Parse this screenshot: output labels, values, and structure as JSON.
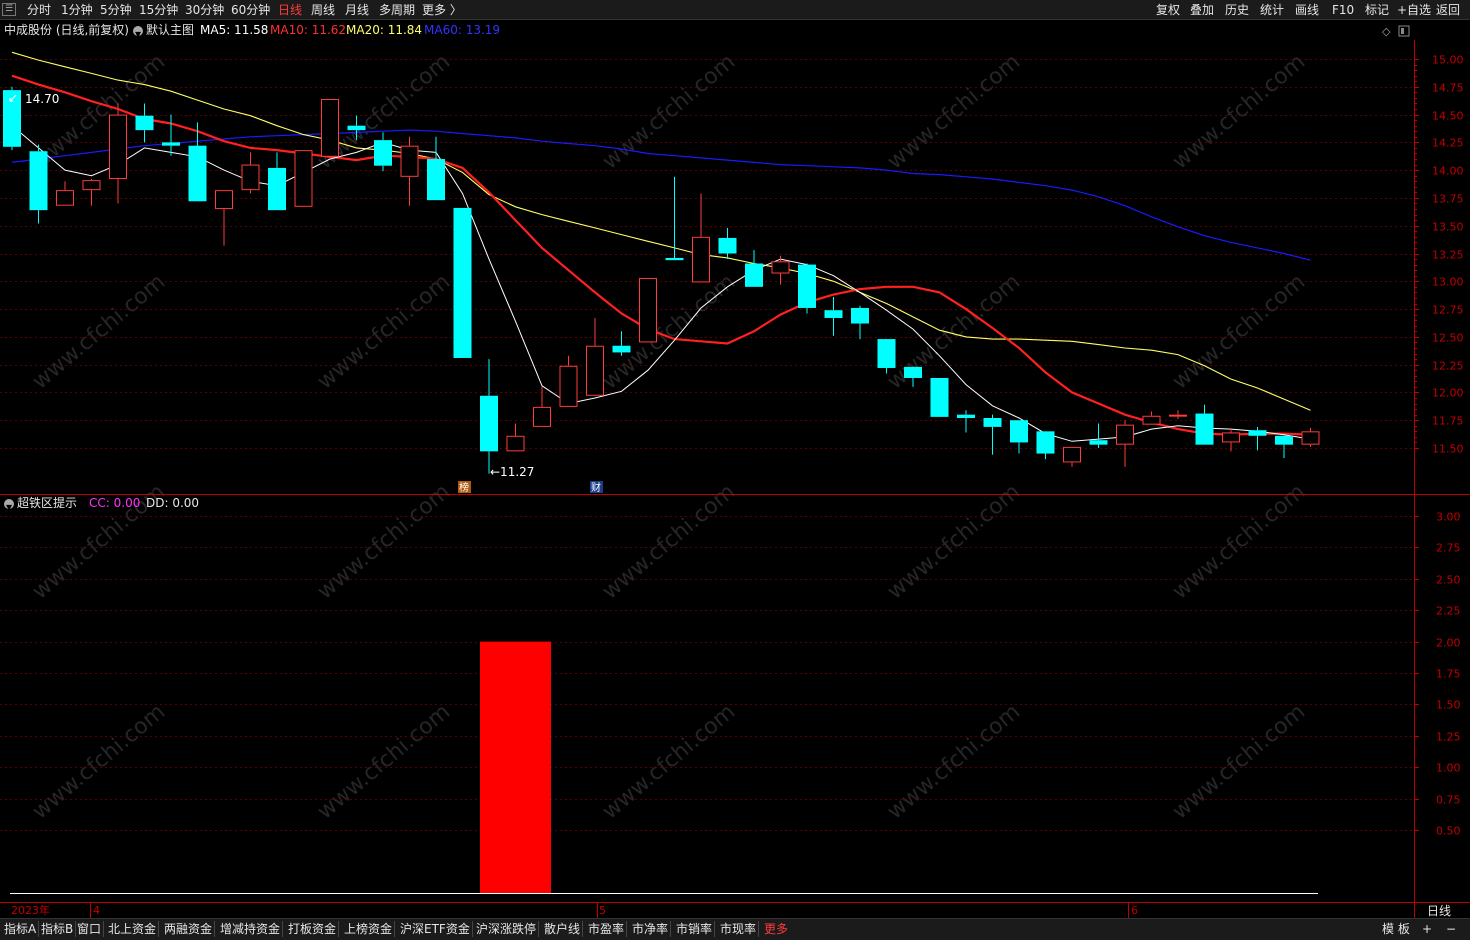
{
  "toolbar": {
    "periods": [
      "分时",
      "1分钟",
      "5分钟",
      "15分钟",
      "30分钟",
      "60分钟",
      "日线",
      "周线",
      "月线",
      "多周期",
      "更多 〉"
    ],
    "active_period": "日线",
    "actions": [
      "复权",
      "叠加",
      "历史",
      "统计",
      "画线",
      "F10",
      "标记",
      "+自选",
      "返回"
    ]
  },
  "infobar": {
    "stock": "中成股份 (日线,前复权)",
    "main_chart": "默认主图",
    "ma5": "MA5: 11.58",
    "ma10": "MA10: 11.62",
    "ma20": "MA20: 11.84",
    "ma60": "MA60: 13.19"
  },
  "colors": {
    "up": "#ff3b3b",
    "down": "#00ffff",
    "ma5": "#ffffff",
    "ma10": "#ff2020",
    "ma20": "#ffff66",
    "ma60": "#1a1aff",
    "axis": "#c00000"
  },
  "price_axis": [
    "15.00",
    "14.75",
    "14.50",
    "14.25",
    "14.00",
    "13.75",
    "13.50",
    "13.25",
    "13.00",
    "12.75",
    "12.50",
    "12.25",
    "12.00",
    "11.75",
    "11.50"
  ],
  "annotations": {
    "high_label": "14.70",
    "low_label": "←11.27",
    "marker_1": "榜",
    "marker_2": "财"
  },
  "indicator": {
    "name": "超铁区提示",
    "cc": "CC: 0.00",
    "dd": "DD: 0.00",
    "axis": [
      "3.00",
      "2.75",
      "2.50",
      "2.25",
      "2.00",
      "1.75",
      "1.50",
      "1.25",
      "1.00",
      "0.75",
      "0.50"
    ],
    "bar_value": 2.0
  },
  "time_axis": {
    "year": "2023年",
    "months": [
      "4",
      "5",
      "6"
    ],
    "period_label": "日线"
  },
  "bottom_tabs": [
    "指标A",
    "指标B",
    "窗口",
    "北上资金",
    "两融资金",
    "增减持资金",
    "打板资金",
    "上榜资金",
    "沪深ETF资金",
    "沪深涨跌停",
    "散户线",
    "市盈率",
    "市净率",
    "市销率",
    "市现率",
    "更多"
  ],
  "bottom_right": {
    "template": "模 板",
    "plus": "+",
    "minus": "−"
  },
  "watermark": "www.cfchi.com",
  "chart_data": {
    "type": "candlestick",
    "candles": [
      {
        "o": 14.72,
        "h": 14.75,
        "c": 14.21,
        "l": 14.18
      },
      {
        "o": 14.17,
        "h": 14.23,
        "c": 13.64,
        "l": 13.52
      },
      {
        "o": 13.68,
        "h": 13.9,
        "c": 13.82,
        "l": 13.68
      },
      {
        "o": 13.82,
        "h": 13.92,
        "c": 13.91,
        "l": 13.68
      },
      {
        "o": 13.92,
        "h": 14.6,
        "c": 14.5,
        "l": 13.7
      },
      {
        "o": 14.49,
        "h": 14.6,
        "c": 14.36,
        "l": 14.25
      },
      {
        "o": 14.25,
        "h": 14.5,
        "c": 14.22,
        "l": 14.13
      },
      {
        "o": 14.22,
        "h": 14.43,
        "c": 13.72,
        "l": 13.72
      },
      {
        "o": 13.65,
        "h": 13.82,
        "c": 13.82,
        "l": 13.32
      },
      {
        "o": 13.82,
        "h": 14.16,
        "c": 14.05,
        "l": 13.79
      },
      {
        "o": 14.02,
        "h": 14.16,
        "c": 13.64,
        "l": 13.64
      },
      {
        "o": 13.67,
        "h": 14.18,
        "c": 14.18,
        "l": 13.67
      },
      {
        "o": 14.12,
        "h": 14.64,
        "c": 14.64,
        "l": 14.1
      },
      {
        "o": 14.4,
        "h": 14.49,
        "c": 14.36,
        "l": 14.27
      },
      {
        "o": 14.27,
        "h": 14.34,
        "c": 14.04,
        "l": 13.99
      },
      {
        "o": 13.94,
        "h": 14.3,
        "c": 14.22,
        "l": 13.68
      },
      {
        "o": 14.1,
        "h": 14.3,
        "c": 13.73,
        "l": 13.73
      },
      {
        "o": 13.66,
        "h": 13.66,
        "c": 12.31,
        "l": 12.31
      },
      {
        "o": 11.97,
        "h": 12.3,
        "c": 11.47,
        "l": 11.27
      },
      {
        "o": 11.47,
        "h": 11.72,
        "c": 11.61,
        "l": 11.47
      },
      {
        "o": 11.69,
        "h": 12.05,
        "c": 11.87,
        "l": 11.69
      },
      {
        "o": 11.87,
        "h": 12.33,
        "c": 12.24,
        "l": 11.87
      },
      {
        "o": 11.97,
        "h": 12.67,
        "c": 12.42,
        "l": 11.97
      },
      {
        "o": 12.42,
        "h": 12.55,
        "c": 12.36,
        "l": 12.33
      },
      {
        "o": 12.45,
        "h": 13.03,
        "c": 13.03,
        "l": 12.45
      },
      {
        "o": 13.21,
        "h": 13.94,
        "c": 13.19,
        "l": 13.19
      },
      {
        "o": 12.99,
        "h": 13.79,
        "c": 13.4,
        "l": 12.99
      },
      {
        "o": 13.39,
        "h": 13.48,
        "c": 13.25,
        "l": 13.2
      },
      {
        "o": 13.16,
        "h": 13.28,
        "c": 12.95,
        "l": 12.95
      },
      {
        "o": 13.07,
        "h": 13.23,
        "c": 13.18,
        "l": 12.97
      },
      {
        "o": 13.15,
        "h": 13.16,
        "c": 12.76,
        "l": 12.71
      },
      {
        "o": 12.74,
        "h": 12.86,
        "c": 12.67,
        "l": 12.51
      },
      {
        "o": 12.76,
        "h": 12.78,
        "c": 12.62,
        "l": 12.48
      },
      {
        "o": 12.48,
        "h": 12.48,
        "c": 12.22,
        "l": 12.17
      },
      {
        "o": 12.23,
        "h": 12.23,
        "c": 12.13,
        "l": 12.05
      },
      {
        "o": 12.13,
        "h": 12.13,
        "c": 11.78,
        "l": 11.78
      },
      {
        "o": 11.8,
        "h": 11.84,
        "c": 11.77,
        "l": 11.64
      },
      {
        "o": 11.77,
        "h": 11.8,
        "c": 11.69,
        "l": 11.44
      },
      {
        "o": 11.75,
        "h": 11.75,
        "c": 11.55,
        "l": 11.45
      },
      {
        "o": 11.65,
        "h": 11.65,
        "c": 11.45,
        "l": 11.4
      },
      {
        "o": 11.37,
        "h": 11.51,
        "c": 11.51,
        "l": 11.33
      },
      {
        "o": 11.57,
        "h": 11.72,
        "c": 11.53,
        "l": 11.5
      },
      {
        "o": 11.53,
        "h": 11.75,
        "c": 11.71,
        "l": 11.33
      },
      {
        "o": 11.71,
        "h": 11.83,
        "c": 11.79,
        "l": 11.71
      },
      {
        "o": 11.79,
        "h": 11.84,
        "c": 11.8,
        "l": 11.76
      },
      {
        "o": 11.81,
        "h": 11.89,
        "c": 11.53,
        "l": 11.53
      },
      {
        "o": 11.55,
        "h": 11.68,
        "c": 11.64,
        "l": 11.47
      },
      {
        "o": 11.66,
        "h": 11.69,
        "c": 11.61,
        "l": 11.48
      },
      {
        "o": 11.61,
        "h": 11.61,
        "c": 11.53,
        "l": 11.41
      },
      {
        "o": 11.53,
        "h": 11.68,
        "c": 11.65,
        "l": 11.51
      }
    ],
    "ma5": [
      14.4,
      14.2,
      14.0,
      13.95,
      14.05,
      14.2,
      14.16,
      14.12,
      14.0,
      13.9,
      13.86,
      13.98,
      14.1,
      14.16,
      14.25,
      14.18,
      14.16,
      13.79,
      13.2,
      12.64,
      12.06,
      11.9,
      11.95,
      12.01,
      12.2,
      12.47,
      12.76,
      12.95,
      13.1,
      13.2,
      13.15,
      13.05,
      12.9,
      12.74,
      12.57,
      12.33,
      12.07,
      11.88,
      11.77,
      11.63,
      11.56,
      11.58,
      11.6,
      11.67,
      11.7,
      11.68,
      11.67,
      11.65,
      11.62,
      11.58
    ],
    "ma10": [
      14.85,
      14.77,
      14.7,
      14.62,
      14.55,
      14.46,
      14.42,
      14.35,
      14.26,
      14.2,
      14.18,
      14.15,
      14.12,
      14.09,
      14.13,
      14.12,
      14.1,
      14.02,
      13.8,
      13.55,
      13.3,
      13.1,
      12.9,
      12.71,
      12.57,
      12.48,
      12.46,
      12.44,
      12.55,
      12.7,
      12.81,
      12.88,
      12.93,
      12.95,
      12.95,
      12.9,
      12.75,
      12.58,
      12.4,
      12.18,
      12.0,
      11.9,
      11.8,
      11.73,
      11.67,
      11.63,
      11.62,
      11.63,
      11.63,
      11.62
    ],
    "ma20": [
      15.06,
      14.99,
      14.93,
      14.87,
      14.81,
      14.77,
      14.71,
      14.63,
      14.55,
      14.49,
      14.4,
      14.32,
      14.27,
      14.2,
      14.18,
      14.15,
      14.1,
      13.98,
      13.78,
      13.67,
      13.6,
      13.54,
      13.48,
      13.42,
      13.36,
      13.3,
      13.24,
      13.21,
      13.16,
      13.12,
      13.07,
      13.0,
      12.9,
      12.8,
      12.68,
      12.56,
      12.5,
      12.48,
      12.48,
      12.47,
      12.46,
      12.43,
      12.4,
      12.38,
      12.34,
      12.24,
      12.12,
      12.04,
      11.94,
      11.84
    ],
    "ma60": [
      14.07,
      14.1,
      14.13,
      14.16,
      14.19,
      14.22,
      14.24,
      14.26,
      14.28,
      14.3,
      14.31,
      14.32,
      14.33,
      14.34,
      14.35,
      14.36,
      14.35,
      14.33,
      14.31,
      14.29,
      14.26,
      14.24,
      14.22,
      14.19,
      14.15,
      14.13,
      14.11,
      14.09,
      14.07,
      14.05,
      14.04,
      14.03,
      14.02,
      14.0,
      13.97,
      13.96,
      13.94,
      13.92,
      13.89,
      13.86,
      13.82,
      13.76,
      13.68,
      13.58,
      13.49,
      13.41,
      13.35,
      13.3,
      13.25,
      13.19
    ],
    "indicator_bar": {
      "from_index": 18,
      "to_index": 20,
      "value": 2.0
    }
  }
}
